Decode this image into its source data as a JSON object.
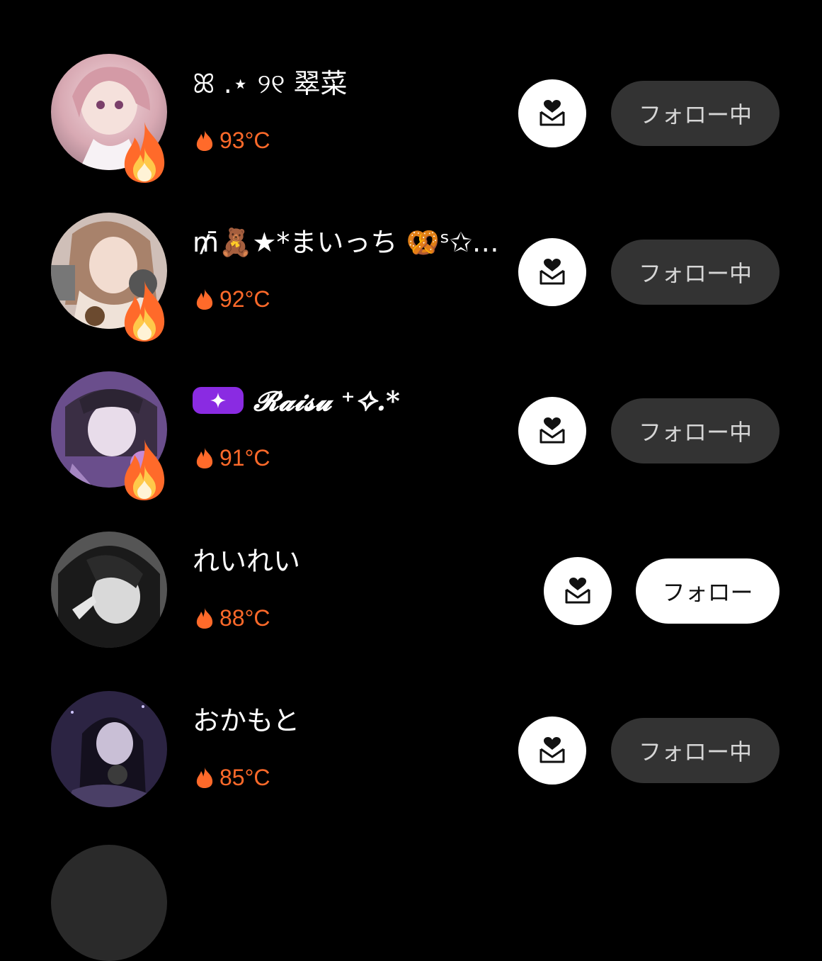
{
  "users": [
    {
      "name": "ꕤ .⋆ ୨୧ 翠菜",
      "temperature": "93°C",
      "follow_label": "フォロー中",
      "following": true,
      "hot": true,
      "italic": false,
      "badge": false
    },
    {
      "name": "₥̄🧸★*まいっち 🥨ˢ✩…",
      "temperature": "92°C",
      "follow_label": "フォロー中",
      "following": true,
      "hot": true,
      "italic": false,
      "badge": false
    },
    {
      "name": "𝓡𝓪𝓲𝓼𝓾 ⁺✧.*",
      "temperature": "91°C",
      "follow_label": "フォロー中",
      "following": true,
      "hot": true,
      "italic": true,
      "badge": true
    },
    {
      "name": "れいれい",
      "temperature": "88°C",
      "follow_label": "フォロー",
      "following": false,
      "hot": false,
      "italic": false,
      "badge": false
    },
    {
      "name": "おかもと",
      "temperature": "85°C",
      "follow_label": "フォロー中",
      "following": true,
      "hot": false,
      "italic": false,
      "badge": false
    }
  ],
  "colors": {
    "background": "#000000",
    "temperature": "#ff6a2a",
    "following_button_bg": "#333333",
    "follow_button_bg": "#ffffff",
    "premium_badge": "#8a2be2"
  },
  "icons": {
    "dm": "heart-envelope-icon",
    "temperature": "fire-icon",
    "hot_badge": "flame-badge-icon",
    "premium": "sparkle-icon"
  }
}
